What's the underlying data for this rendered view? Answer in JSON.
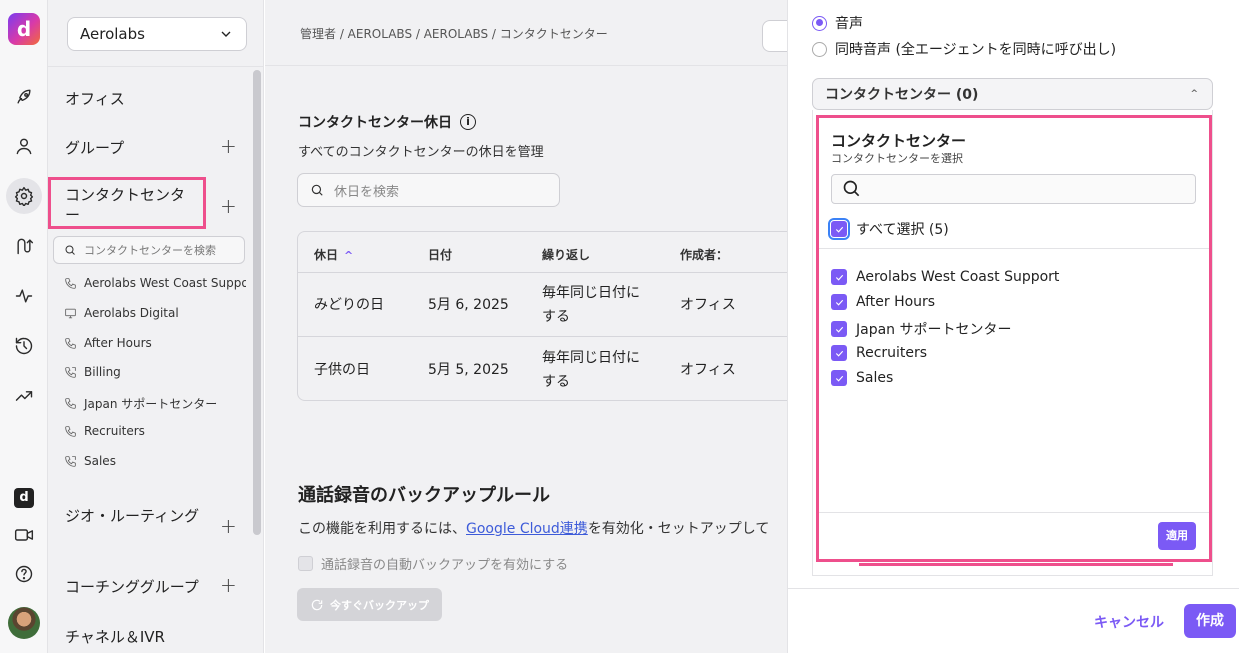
{
  "app": {
    "logo_letter": "d",
    "small_logo_letter": "d"
  },
  "rail": {
    "icons": [
      "rocket-icon",
      "user-icon",
      "gear-icon",
      "routing-icon",
      "activity-icon",
      "history-icon",
      "trending-icon"
    ],
    "bottom_icons": [
      "dialpad-logo-icon",
      "video-icon",
      "help-icon",
      "avatar"
    ]
  },
  "sidebar": {
    "org_select": "Aerolabs",
    "nav": {
      "office": "オフィス",
      "groups": "グループ",
      "contact_center": "コンタクトセンター",
      "geo_routing": "ジオ・ルーティング",
      "coaching_groups": "コーチンググループ",
      "channels_ivr": "チャネル＆IVR"
    },
    "plus": "+",
    "cc_search_placeholder": "コンタクトセンターを検索",
    "contact_centers": [
      {
        "label": "Aerolabs West Coast Support",
        "icon": "phone-icon"
      },
      {
        "label": "Aerolabs Digital",
        "icon": "monitor-icon"
      },
      {
        "label": "After Hours",
        "icon": "phone-icon"
      },
      {
        "label": "Billing",
        "icon": "phone-forward-icon"
      },
      {
        "label": "Japan サポートセンター",
        "icon": "phone-icon"
      },
      {
        "label": "Recruiters",
        "icon": "phone-icon"
      },
      {
        "label": "Sales",
        "icon": "phone-forward-icon"
      }
    ]
  },
  "main": {
    "breadcrumb": "管理者 / AEROLABS / AEROLABS / コンタクトセンター",
    "holidays": {
      "title": "コンタクトセンター休日",
      "info": "i",
      "subtitle": "すべてのコンタクトセンターの休日を管理",
      "search_placeholder": "休日を検索",
      "columns": [
        "休日",
        "日付",
        "繰り返し",
        "作成者："
      ],
      "sort_indicator": "^",
      "rows": [
        {
          "name": "みどりの日",
          "date": "5月 6, 2025",
          "repeat_line1": "毎年同じ日付に",
          "repeat_line2": "する",
          "creator": "オフィス"
        },
        {
          "name": "子供の日",
          "date": "5月 5, 2025",
          "repeat_line1": "毎年同じ日付に",
          "repeat_line2": "する",
          "creator": "オフィス"
        }
      ]
    },
    "backup": {
      "title": "通話録音のバックアップルール",
      "desc_prefix": "この機能を利用するには、",
      "desc_link": "Google Cloud連携",
      "desc_suffix": "を有効化・セットアップして",
      "checkbox_label": "通話録音の自動バックアップを有効にする",
      "button_label": "今すぐバックアップ"
    }
  },
  "panel": {
    "radio_voice": "音声",
    "radio_simul": "同時音声 (全エージェントを同時に呼び出し)",
    "dropdown_label": "コンタクトセンター (0)",
    "dropdown_caret": "^",
    "menu": {
      "title": "コンタクトセンター",
      "subtitle": "コンタクトセンターを選択",
      "select_all": "すべて選択 (5)",
      "options": [
        "Aerolabs West Coast Support",
        "After Hours",
        "Japan サポートセンター",
        "Recruiters",
        "Sales"
      ],
      "apply": "適用"
    },
    "cancel": "キャンセル",
    "create": "作成"
  },
  "colors": {
    "accent": "#7b5af5",
    "highlight": "#ee4f8c",
    "link": "#3d5bd9"
  }
}
